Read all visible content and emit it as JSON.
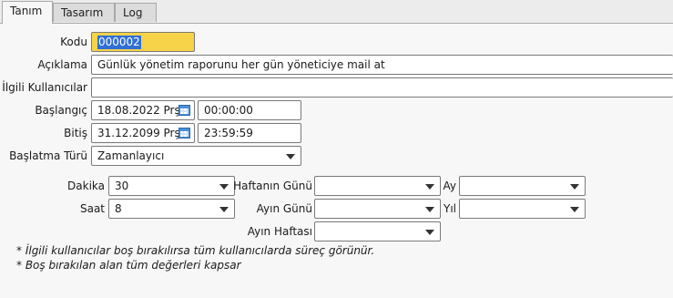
{
  "tabs": [
    {
      "label": "Tanım"
    },
    {
      "label": "Tasarım"
    },
    {
      "label": "Log"
    }
  ],
  "form": {
    "kodu": {
      "label": "Kodu",
      "value": "000002"
    },
    "aciklama": {
      "label": "Açıklama",
      "value": "Günlük yönetim raporunu her gün yöneticiye mail at"
    },
    "ilgili": {
      "label": "İlgili Kullanıcılar",
      "value": ""
    },
    "baslangic": {
      "label": "Başlangıç",
      "date": "18.08.2022 Prş",
      "time": "00:00:00"
    },
    "bitis": {
      "label": "Bitiş",
      "date": "31.12.2099 Prş",
      "time": "23:59:59"
    },
    "baslatma_turu": {
      "label": "Başlatma Türü",
      "value": "Zamanlayıcı"
    }
  },
  "schedule": {
    "dakika": {
      "label": "Dakika",
      "value": "30"
    },
    "saat": {
      "label": "Saat",
      "value": "8"
    },
    "haftanin_gunu": {
      "label": "Haftanın Günü",
      "value": ""
    },
    "ayin_gunu": {
      "label": "Ayın Günü",
      "value": ""
    },
    "ayin_haftasi": {
      "label": "Ayın Haftası",
      "value": ""
    },
    "ay": {
      "label": "Ay",
      "value": ""
    },
    "yil": {
      "label": "Yıl",
      "value": ""
    }
  },
  "notes": [
    "* İlgili kullanıcılar boş bırakılırsa tüm kullanıcılarda süreç görünür.",
    "* Boş bırakılan alan tüm değerleri kapsar"
  ],
  "colors": {
    "kodu_field_bg": "#f7d34a",
    "selection": "#2f6fd6"
  }
}
